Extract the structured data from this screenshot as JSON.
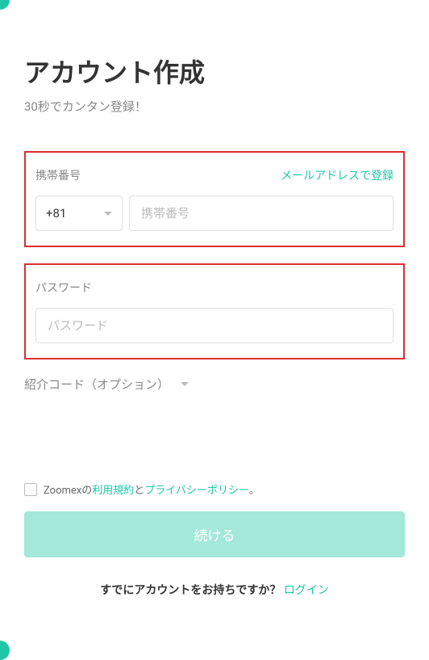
{
  "header": {
    "title": "アカウント作成",
    "subtitle": "30秒でカンタン登録！"
  },
  "phone_section": {
    "label": "携帯番号",
    "toggle_link": "メールアドレスで登録",
    "country_code": "+81",
    "placeholder": "携帯番号"
  },
  "password_section": {
    "label": "パスワード",
    "placeholder": "パスワード"
  },
  "referral": {
    "label": "紹介コード（オプション）"
  },
  "terms": {
    "prefix": "Zoomexの",
    "tos": "利用規約",
    "connector": "と",
    "privacy": "プライバシーポリシー",
    "suffix": "。"
  },
  "submit": {
    "label": "続ける"
  },
  "login": {
    "prompt": "すでにアカウントをお持ちですか？ ",
    "link": "ログイン"
  }
}
